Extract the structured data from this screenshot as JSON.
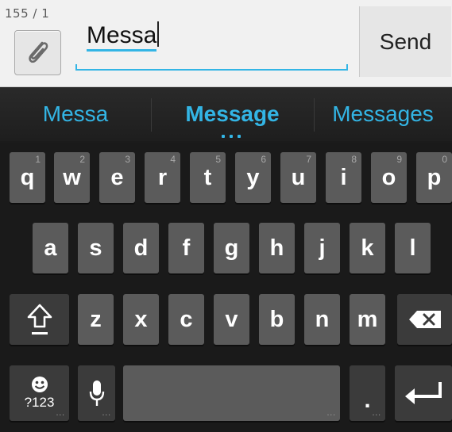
{
  "compose": {
    "counter": "155 / 1",
    "typed_text": "Messa",
    "send_label": "Send",
    "accent_color": "#33b5e5"
  },
  "suggestions": [
    "Messa",
    "Message",
    "Messages"
  ],
  "keyboard": {
    "row1": [
      {
        "label": "q",
        "hint": "1"
      },
      {
        "label": "w",
        "hint": "2"
      },
      {
        "label": "e",
        "hint": "3"
      },
      {
        "label": "r",
        "hint": "4"
      },
      {
        "label": "t",
        "hint": "5"
      },
      {
        "label": "y",
        "hint": "6"
      },
      {
        "label": "u",
        "hint": "7"
      },
      {
        "label": "i",
        "hint": "8"
      },
      {
        "label": "o",
        "hint": "9"
      },
      {
        "label": "p",
        "hint": "0"
      }
    ],
    "row2": [
      "a",
      "s",
      "d",
      "f",
      "g",
      "h",
      "j",
      "k",
      "l"
    ],
    "row3": [
      "z",
      "x",
      "c",
      "v",
      "b",
      "n",
      "m"
    ],
    "symbols_label": "?123",
    "period_label": ".",
    "icons": {
      "shift": "shift-arrow-icon",
      "backspace": "backspace-icon",
      "mic": "microphone-icon",
      "emoji": "smiley-icon",
      "enter": "enter-return-icon",
      "attach": "paperclip-icon"
    }
  }
}
